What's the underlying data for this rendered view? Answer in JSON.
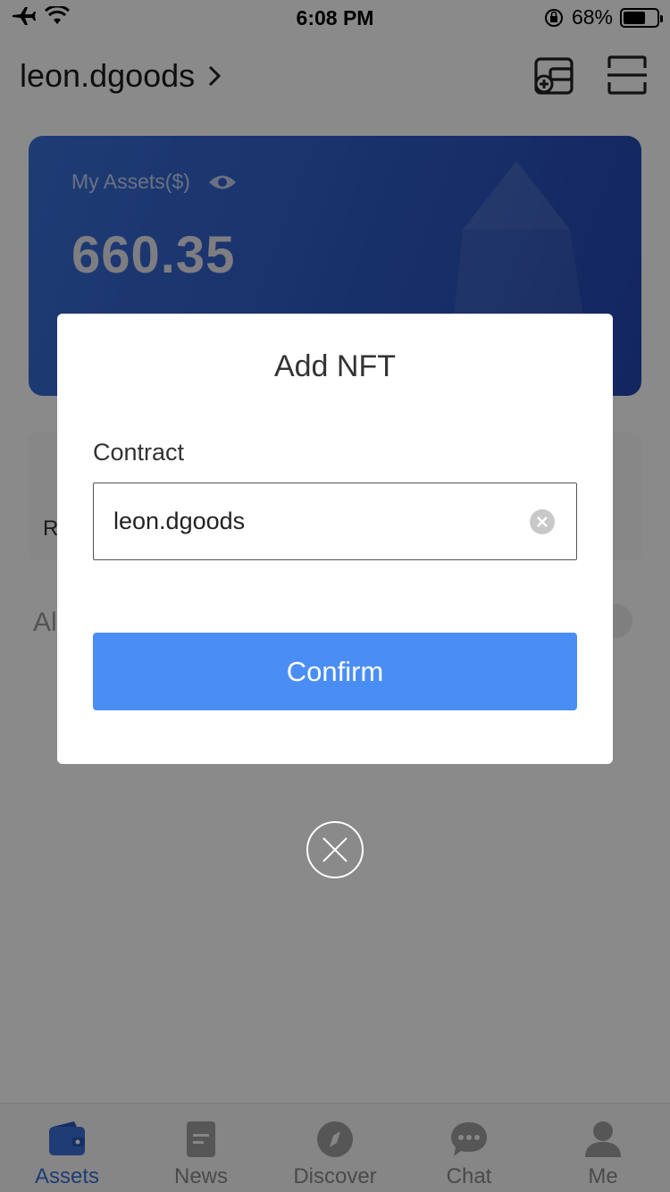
{
  "status_bar": {
    "time": "6:08 PM",
    "battery_percent": "68%",
    "battery_level": 0.68,
    "icons": [
      "airplane-icon",
      "wifi-icon",
      "orientation-lock-icon",
      "battery-icon"
    ]
  },
  "header": {
    "account_name": "leon.dgoods",
    "chevron": "›",
    "icons": [
      "wallet-add-icon",
      "scan-icon"
    ]
  },
  "asset_card": {
    "label": "My Assets($)",
    "value": "660.35",
    "icon": "eye-icon"
  },
  "background": {
    "section_letter": "R",
    "all_label": "Al"
  },
  "modal": {
    "title": "Add NFT",
    "field_label": "Contract",
    "input_value": "leon.dgoods",
    "confirm_label": "Confirm"
  },
  "tab_bar": {
    "tabs": [
      {
        "label": "Assets",
        "icon": "wallet-icon",
        "active": true
      },
      {
        "label": "News",
        "icon": "document-icon",
        "active": false
      },
      {
        "label": "Discover",
        "icon": "compass-icon",
        "active": false
      },
      {
        "label": "Chat",
        "icon": "chat-bubble-icon",
        "active": false
      },
      {
        "label": "Me",
        "icon": "person-icon",
        "active": false
      }
    ]
  },
  "colors": {
    "accent": "#4a8ef5",
    "card_blue": "#2f5cc6",
    "tab_active": "#3a6fd8"
  }
}
